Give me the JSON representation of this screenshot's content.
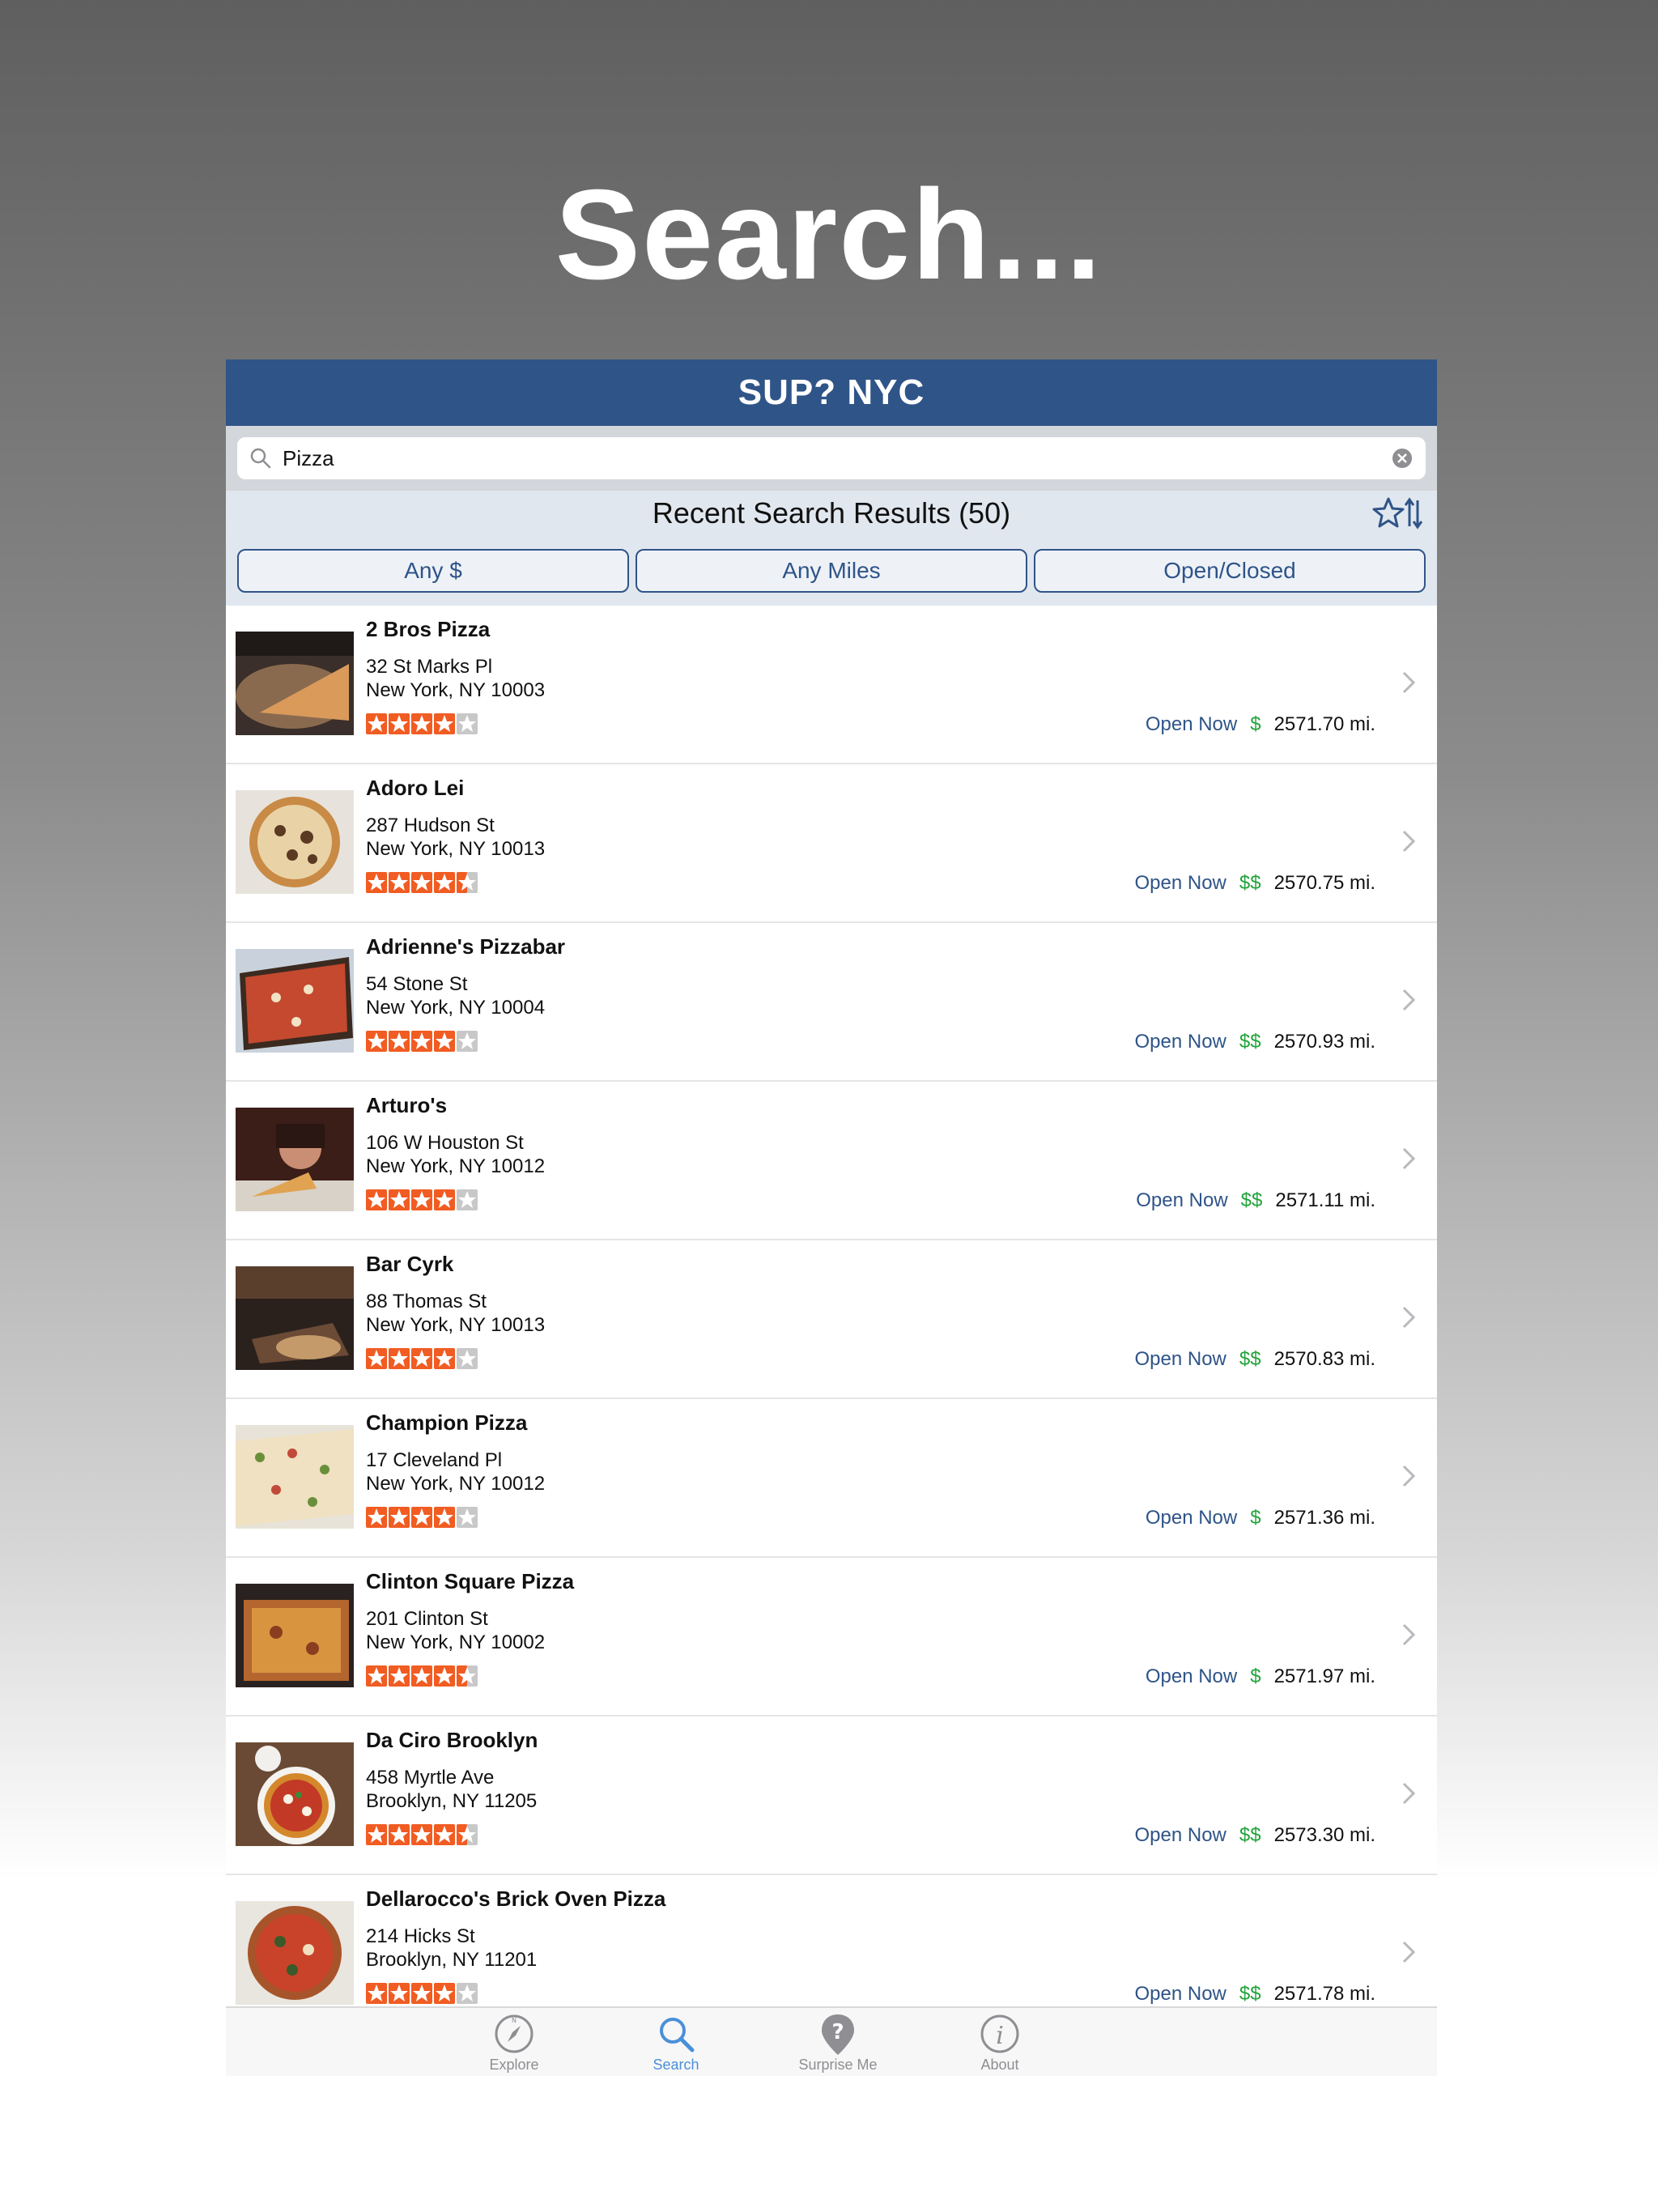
{
  "headline": "Search...",
  "app": {
    "title": "SUP? NYC"
  },
  "search": {
    "value": "Pizza"
  },
  "results": {
    "title": "Recent Search Results (50)"
  },
  "filters": [
    "Any $",
    "Any Miles",
    "Open/Closed"
  ],
  "colors": {
    "nav": "#2f5488",
    "star_fill": "#f15c22",
    "star_empty": "#c8c8c8",
    "open": "#2f5488",
    "price": "#22a33a",
    "tab_active": "#4a90d9"
  },
  "restaurants": [
    {
      "name": "2 Bros Pizza",
      "address1": "32 St Marks Pl",
      "address2": "New York, NY 10003",
      "rating": 4,
      "status": "Open Now",
      "price": "$",
      "distance": "2571.70 mi."
    },
    {
      "name": "Adoro Lei",
      "address1": "287 Hudson St",
      "address2": "New York, NY 10013",
      "rating": 4.5,
      "status": "Open Now",
      "price": "$$",
      "distance": "2570.75 mi."
    },
    {
      "name": "Adrienne's Pizzabar",
      "address1": "54 Stone St",
      "address2": "New York, NY 10004",
      "rating": 4,
      "status": "Open Now",
      "price": "$$",
      "distance": "2570.93 mi."
    },
    {
      "name": "Arturo's",
      "address1": "106 W Houston St",
      "address2": "New York, NY 10012",
      "rating": 4,
      "status": "Open Now",
      "price": "$$",
      "distance": "2571.11 mi."
    },
    {
      "name": "Bar Cyrk",
      "address1": "88 Thomas St",
      "address2": "New York, NY 10013",
      "rating": 4,
      "status": "Open Now",
      "price": "$$",
      "distance": "2570.83 mi."
    },
    {
      "name": "Champion Pizza",
      "address1": "17 Cleveland Pl",
      "address2": "New York, NY 10012",
      "rating": 4,
      "status": "Open Now",
      "price": "$",
      "distance": "2571.36 mi."
    },
    {
      "name": "Clinton Square Pizza",
      "address1": "201 Clinton St",
      "address2": "New York, NY 10002",
      "rating": 4.5,
      "status": "Open Now",
      "price": "$",
      "distance": "2571.97 mi."
    },
    {
      "name": "Da Ciro Brooklyn",
      "address1": "458 Myrtle Ave",
      "address2": "Brooklyn, NY 11205",
      "rating": 4.5,
      "status": "Open Now",
      "price": "$$",
      "distance": "2573.30 mi."
    },
    {
      "name": "Dellarocco's Brick Oven Pizza",
      "address1": "214 Hicks St",
      "address2": "Brooklyn, NY 11201",
      "rating": 4,
      "status": "Open Now",
      "price": "$$",
      "distance": "2571.78 mi."
    }
  ],
  "tabs": [
    {
      "label": "Explore",
      "icon": "compass-icon",
      "active": false
    },
    {
      "label": "Search",
      "icon": "magnifier-icon",
      "active": true
    },
    {
      "label": "Surprise Me",
      "icon": "question-pin-icon",
      "active": false
    },
    {
      "label": "About",
      "icon": "info-icon",
      "active": false
    }
  ]
}
